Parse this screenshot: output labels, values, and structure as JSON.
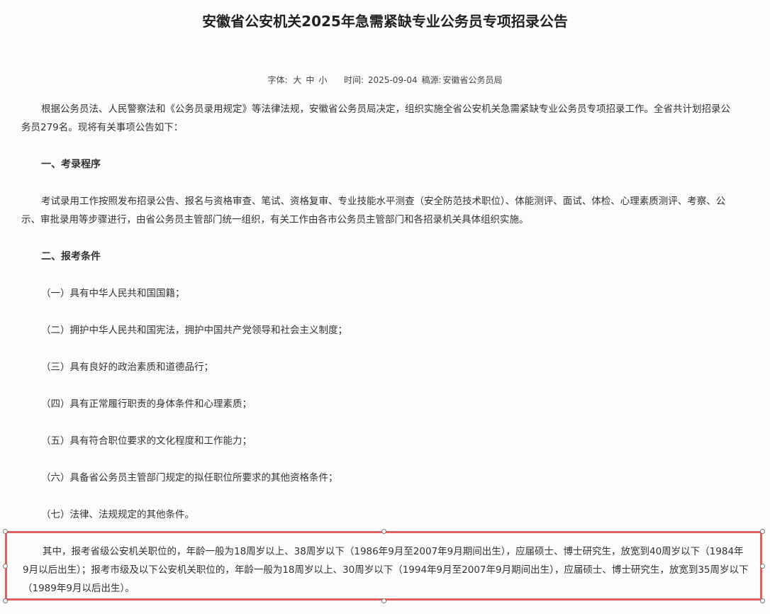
{
  "article": {
    "title": "安徽省公安机关2025年急需紧缺专业公务员专项招录公告",
    "meta": {
      "font_label": "字体:",
      "size_large": "大",
      "size_medium": "中",
      "size_small": "小",
      "time_label": "时间:",
      "time_value": "2025-09-04",
      "source_label": "稿源:",
      "source_value": "安徽省公务员局"
    },
    "intro": "根据公务员法、人民警察法和《公务员录用规定》等法律法规，安徽省公务员局决定，组织实施全省公安机关急需紧缺专业公务员专项招录工作。全省共计划招录公务员279名。现将有关事项公告如下：",
    "section1_heading": "一、考录程序",
    "section1_text": "考试录用工作按照发布招录公告、报名与资格审查、笔试、资格复审、专业技能水平测查（安全防范技术职位）、体能测评、面试、体检、心理素质测评、考察、公示、审批录用等步骤进行，由省公务员主管部门统一组织，有关工作由各市公务员主管部门和各招录机关具体组织实施。",
    "section2_heading": "二、报考条件",
    "conditions": [
      "（一）具有中华人民共和国国籍；",
      "（二）拥护中华人民共和国宪法，拥护中国共产党领导和社会主义制度；",
      "（三）具有良好的政治素质和道德品行；",
      "（四）具有正常履行职责的身体条件和心理素质；",
      "（五）具有符合职位要求的文化程度和工作能力；",
      "（六）具备省公务员主管部门规定的拟任职位所要求的其他资格条件；",
      "（七）法律、法规规定的其他条件。"
    ],
    "age_note": "其中，报考省级公安机关职位的，年龄一般为18周岁以上、38周岁以下（1986年9月至2007年9月期间出生），应届硕士、博士研究生，放宽到40周岁以下（1984年9月以后出生）；报考市级及以下公安机关职位的，年龄一般为18周岁以上、30周岁以下（1994年9月至2007年9月期间出生），应届硕士、博士研究生，放宽到35周岁以下（1989年9月以后出生）。"
  },
  "colors": {
    "highlight_border": "#e06060",
    "text": "#333333",
    "background": "#fcfcfc"
  }
}
